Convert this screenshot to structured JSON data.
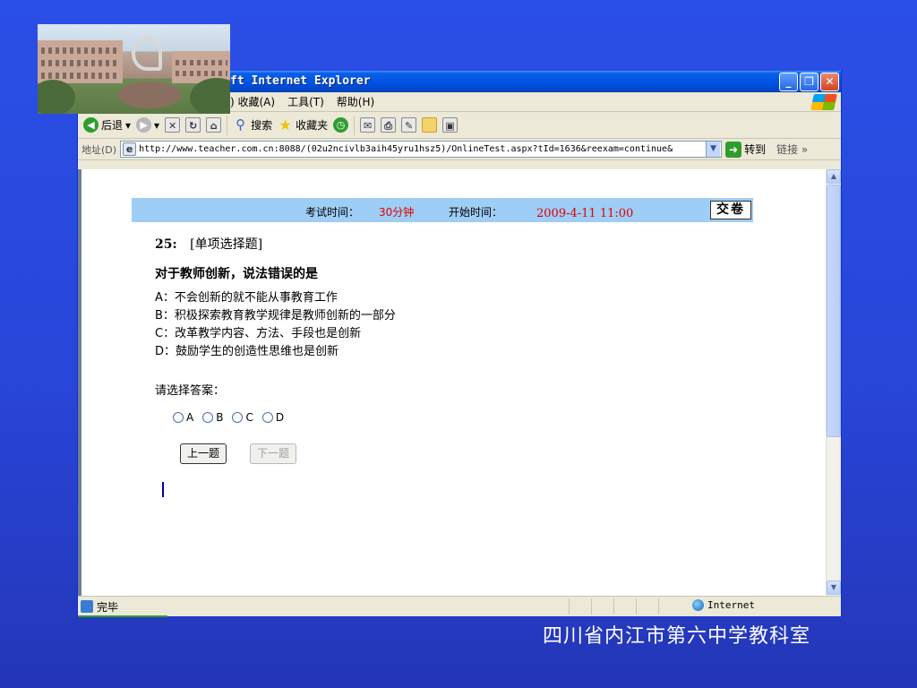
{
  "window": {
    "title": "ft Internet Explorer",
    "buttons": {
      "minimize": "_",
      "maximize": "❐",
      "close": "✕"
    }
  },
  "menu": {
    "items": [
      ") 收藏(A)",
      "工具(T)",
      "帮助(H)"
    ]
  },
  "toolbar": {
    "back": "后退",
    "search": "搜索",
    "favorites": "收藏夹"
  },
  "address": {
    "label": "地址(D)",
    "url": "http://www.teacher.com.cn:8088/(02u2ncivlb3aih45yru1hsz5)/OnlineTest.aspx?tId=1636&reexam=continue&",
    "go": "转到",
    "links": "链接",
    "links_more": "»"
  },
  "exam": {
    "time_label": "考试时间：",
    "time_value": "30分钟",
    "start_label": "开始时间：",
    "start_value": "2009-4-11   11:00",
    "submit": "交卷",
    "question_number": "25:",
    "question_type": "[单项选择题]",
    "question_text": "对于教师创新，说法错误的是",
    "options": [
      "A：不会创新的就不能从事教育工作",
      "B：积极探索教育教学规律是教师创新的一部分",
      "C：改革教学内容、方法、手段也是创新",
      "D：鼓励学生的创造性思维也是创新"
    ],
    "prompt": "请选择答案：",
    "radio_labels": [
      "A",
      "B",
      "C",
      "D"
    ],
    "prev": "上一题",
    "next": "下一题"
  },
  "status": {
    "text": "完毕",
    "zone": "Internet"
  },
  "footer": {
    "caption": "四川省内江市第六中学教科室"
  },
  "colors": {
    "background": "#2846d8",
    "exam_header": "#9ecdf5",
    "highlight_red": "#e00000"
  }
}
